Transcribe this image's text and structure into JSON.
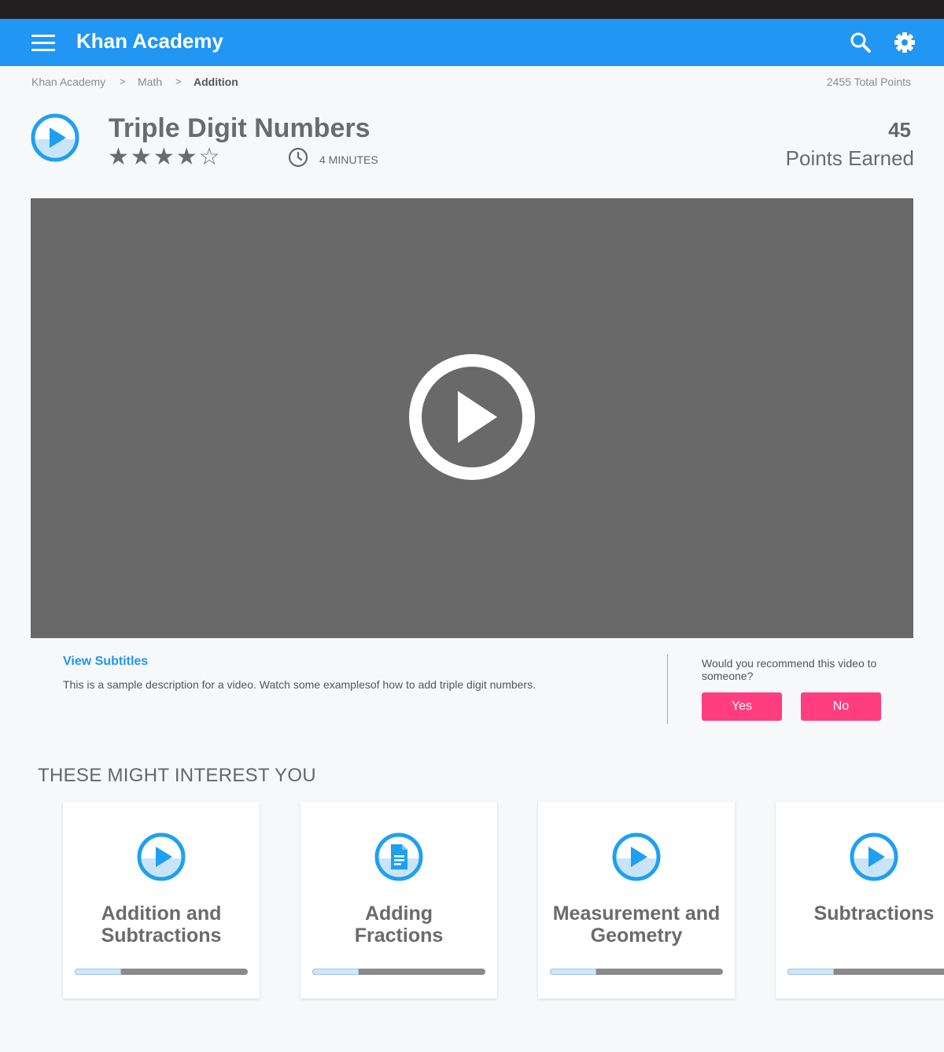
{
  "app": {
    "title": "Khan Academy"
  },
  "header": {
    "menu_icon": "hamburger-menu-icon",
    "search_icon": "search-icon",
    "settings_icon": "gear-icon",
    "bar_color": "#2196f3"
  },
  "breadcrumb": {
    "items": [
      "Khan Academy",
      "Math",
      "Addition"
    ],
    "separator": ">"
  },
  "total_points": "2455 Total Points",
  "lesson": {
    "title": "Triple Digit Numbers",
    "rating": 4,
    "rating_max": 5,
    "duration": "4 MINUTES",
    "points_value": "45",
    "points_label": "Points Earned"
  },
  "video": {
    "player_icon": "play-circle-icon"
  },
  "details": {
    "subtitles_link": "View Subtitles",
    "description": "This is a sample description for a video. Watch some examplesof how to add triple digit numbers."
  },
  "recommend": {
    "question": "Would you recommend this video to someone?",
    "yes_label": "Yes",
    "no_label": "No",
    "button_color": "#ff3d7f"
  },
  "suggestions": {
    "heading": "THESE MIGHT INTEREST YOU",
    "cards": [
      {
        "title_line1": "Addition and",
        "title_line2": "Subtractions",
        "icon": "video-icon",
        "progress": 0.27
      },
      {
        "title_line1": "Adding",
        "title_line2": "Fractions",
        "icon": "article-icon",
        "progress": 0.27
      },
      {
        "title_line1": "Measurement and",
        "title_line2": "Geometry",
        "icon": "video-icon",
        "progress": 0.27
      },
      {
        "title_line1": "Subtractions",
        "title_line2": "",
        "icon": "video-icon",
        "progress": 0.27
      }
    ]
  }
}
